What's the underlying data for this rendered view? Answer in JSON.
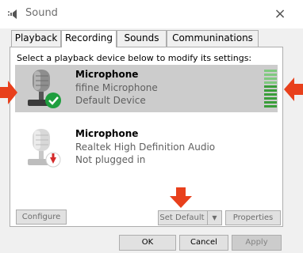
{
  "window": {
    "title": "Sound",
    "close_glyph": "×",
    "title_icon": "speaker-icon"
  },
  "tabs": [
    {
      "label": "Playback",
      "active": false
    },
    {
      "label": "Recording",
      "active": true
    },
    {
      "label": "Sounds",
      "active": false
    },
    {
      "label": "Communinations",
      "active": false
    }
  ],
  "panel": {
    "instruction": "Select a playback device below to modify its settings:"
  },
  "devices": [
    {
      "name": "Microphone",
      "line1": "fifine Microphone",
      "line2": "Default Device",
      "selected": true,
      "status_icon": "green-check-icon",
      "level_fraction": 1.0
    },
    {
      "name": "Microphone",
      "line1": "Realtek High Definition Audio",
      "line2": "Not plugged in",
      "selected": false,
      "status_icon": "red-down-arrow-icon"
    }
  ],
  "panel_buttons": {
    "configure": "Configure",
    "set_default": "Set Default",
    "set_default_arrow": "▼",
    "properties": "Properties"
  },
  "dialog_buttons": {
    "ok": "OK",
    "cancel": "Cancel",
    "apply": "Apply"
  },
  "colors": {
    "selection": "#cccccc",
    "level_green": "#3a9e3a",
    "annotation_red": "#e8401c",
    "check_green": "#1e9e3e"
  }
}
